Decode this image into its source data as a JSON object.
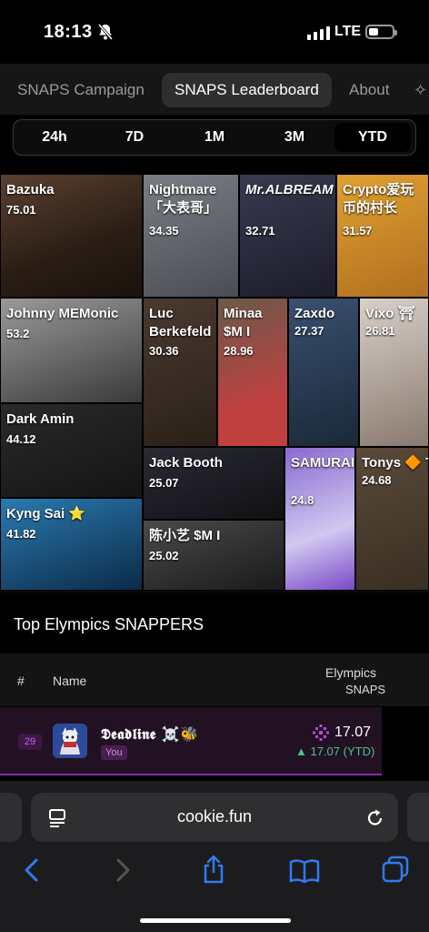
{
  "status_bar": {
    "time": "18:13",
    "network": "LTE"
  },
  "nav": {
    "tabs": [
      "SNAPS Campaign",
      "SNAPS Leaderboard",
      "About"
    ],
    "active": "SNAPS Leaderboard"
  },
  "periods": {
    "items": [
      "24h",
      "7D",
      "1M",
      "3M",
      "YTD"
    ],
    "active": "YTD"
  },
  "mosaic": [
    {
      "name": "Bazuka",
      "score": "75.01"
    },
    {
      "name": "Nightmare\n「大表哥」",
      "score": "34.35"
    },
    {
      "name": "Mr.ALBREAM",
      "score": "32.71"
    },
    {
      "name": "Crypto爱玩\n币的村长",
      "score": "31.57"
    },
    {
      "name": "Johnny MEMonic",
      "score": "53.2"
    },
    {
      "name": "Luc\nBerkefeld",
      "score": "30.36"
    },
    {
      "name": "Minaa\n$M I",
      "score": "28.96"
    },
    {
      "name": "Zaxdo",
      "score": "27.37"
    },
    {
      "name": "Vixo ⛩",
      "score": "26.81"
    },
    {
      "name": "Dark Amin",
      "score": "44.12"
    },
    {
      "name": "Jack Booth",
      "score": "25.07"
    },
    {
      "name": "SAMURAI",
      "score": "24.8"
    },
    {
      "name": "Tonys 🔶 Tu",
      "score": "24.68"
    },
    {
      "name": "Kyng Sai ⭐",
      "score": "41.82"
    },
    {
      "name": "陈小艺 $M I",
      "score": "25.02"
    }
  ],
  "leaderboard": {
    "title": "Top Elympics SNAPPERS",
    "headers": {
      "rank": "#",
      "name": "Name",
      "snaps_line1": "Elympics",
      "snaps_line2": "SNAPS"
    },
    "rows": [
      {
        "rank": "29",
        "name": "𝕯𝖊𝖆𝖉𝖑𝖎𝖓𝖊 ☠️🐝",
        "badge": "You",
        "snaps": "17.07",
        "ytd": "▲ 17.07 (YTD)"
      }
    ]
  },
  "browser": {
    "url": "cookie.fun"
  },
  "colors": {
    "accent_purple": "#8a2aa8",
    "positive_green": "#4ac28a",
    "badge_purple": "#c06bd8"
  }
}
